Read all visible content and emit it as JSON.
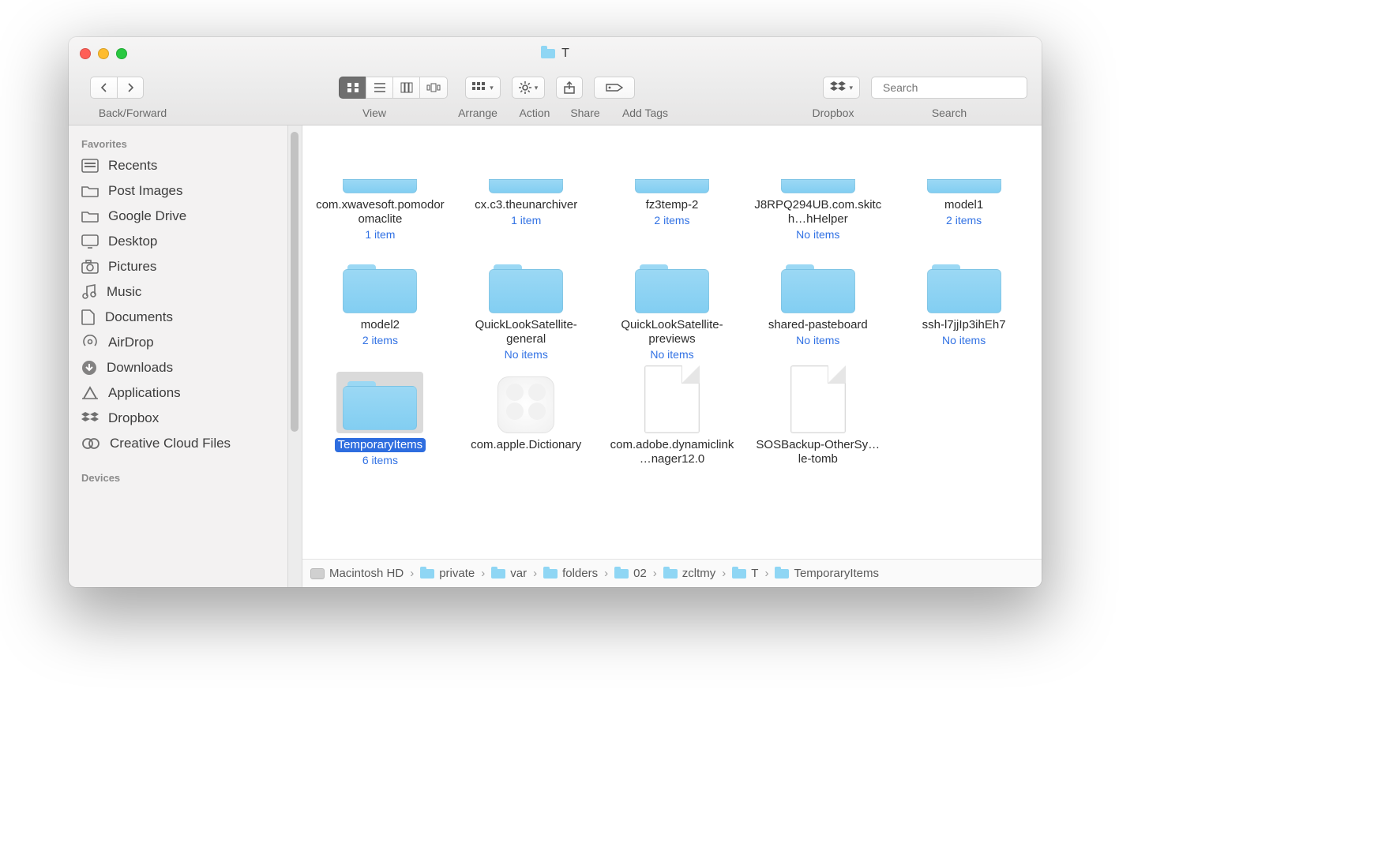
{
  "title": "T",
  "toolbar": {
    "back_forward_label": "Back/Forward",
    "view_label": "View",
    "arrange_label": "Arrange",
    "action_label": "Action",
    "share_label": "Share",
    "add_tags_label": "Add Tags",
    "dropbox_label": "Dropbox",
    "search_label": "Search",
    "search_placeholder": "Search"
  },
  "sidebar": {
    "favorites_header": "Favorites",
    "devices_header": "Devices",
    "items": [
      {
        "label": "Recents"
      },
      {
        "label": "Post Images"
      },
      {
        "label": "Google Drive"
      },
      {
        "label": "Desktop"
      },
      {
        "label": "Pictures"
      },
      {
        "label": "Music"
      },
      {
        "label": "Documents"
      },
      {
        "label": "AirDrop"
      },
      {
        "label": "Downloads"
      },
      {
        "label": "Applications"
      },
      {
        "label": "Dropbox"
      },
      {
        "label": "Creative Cloud Files"
      }
    ]
  },
  "files": {
    "row0": [
      {
        "name": "com.xwavesoft.pomodoromaclite",
        "sub": "1 item"
      },
      {
        "name": "cx.c3.theunarchiver",
        "sub": "1 item"
      },
      {
        "name": "fz3temp-2",
        "sub": "2 items"
      },
      {
        "name": "J8RPQ294UB.com.skitch…hHelper",
        "sub": "No items"
      },
      {
        "name": "model1",
        "sub": "2 items"
      }
    ],
    "row1": [
      {
        "name": "model2",
        "sub": "2 items"
      },
      {
        "name": "QuickLookSatellite-general",
        "sub": "No items"
      },
      {
        "name": "QuickLookSatellite-previews",
        "sub": "No items"
      },
      {
        "name": "shared-pasteboard",
        "sub": "No items"
      },
      {
        "name": "ssh-l7jjIp3ihEh7",
        "sub": "No items"
      }
    ],
    "row2": [
      {
        "name": "TemporaryItems",
        "sub": "6 items",
        "selected": true
      },
      {
        "name": "com.apple.Dictionary",
        "kind": "kext"
      },
      {
        "name": "com.adobe.dynamiclink…nager12.0",
        "kind": "doc"
      },
      {
        "name": "SOSBackup-OtherSy…le-tomb",
        "kind": "doc"
      }
    ]
  },
  "path": [
    "Macintosh HD",
    "private",
    "var",
    "folders",
    "02",
    "zcltmy",
    "T",
    "TemporaryItems"
  ]
}
